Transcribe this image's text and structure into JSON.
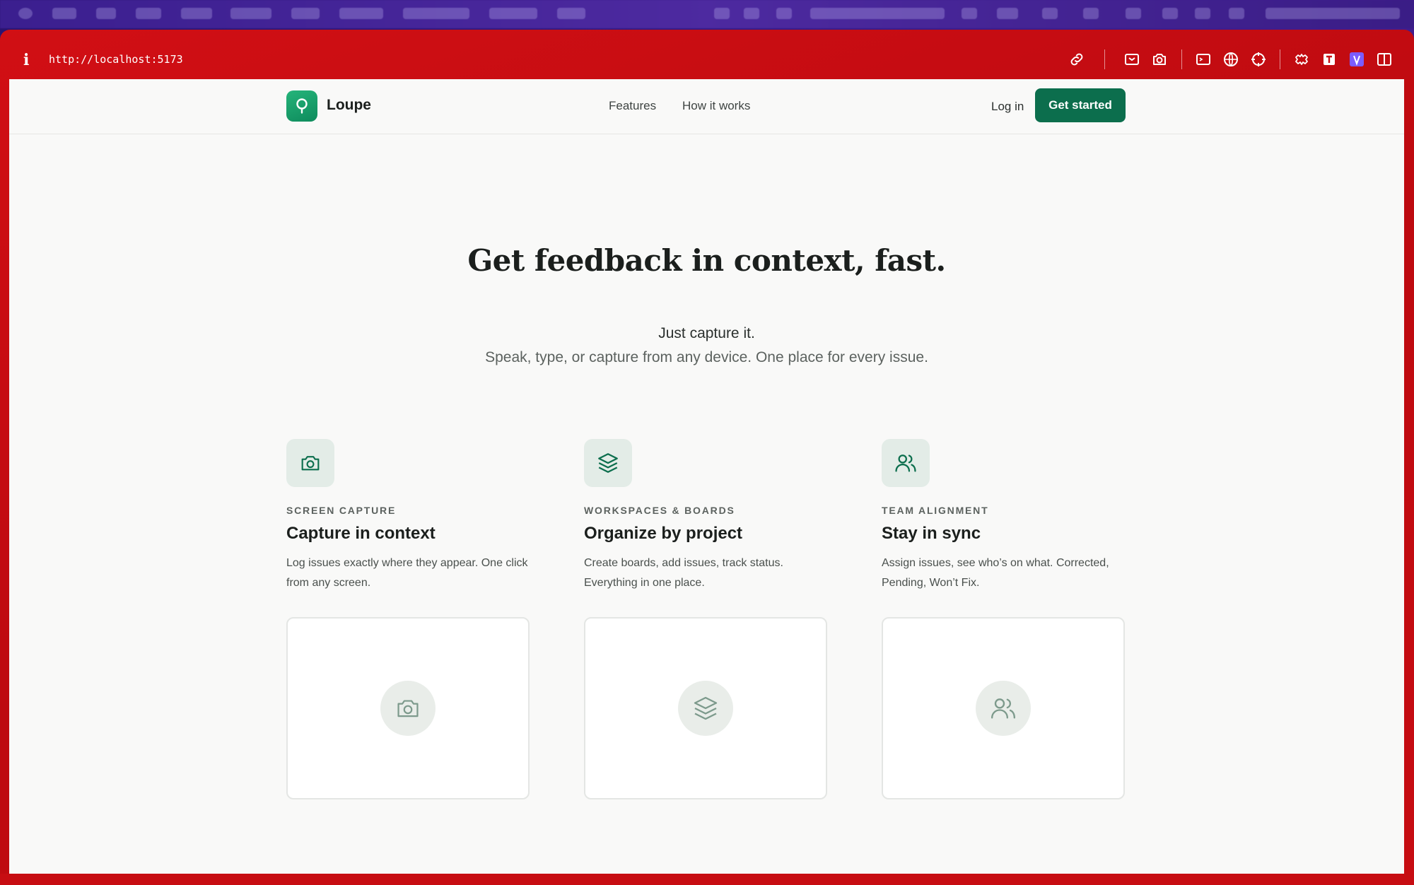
{
  "browser": {
    "url": "http://localhost:5173",
    "info_icon": "i"
  },
  "site": {
    "brand": "Loupe",
    "nav_links": [
      "Features",
      "How it works"
    ],
    "login_label": "Log in",
    "cta_label": "Get started"
  },
  "hero": {
    "title": "Get feedback in context, fast.",
    "subtitle": "Just capture it.",
    "description": "Speak, type, or capture from any device. One place for every issue."
  },
  "features": [
    {
      "icon": "camera-icon",
      "eyebrow": "SCREEN CAPTURE",
      "title": "Capture in context",
      "description": "Log issues exactly where they appear. One click from any screen."
    },
    {
      "icon": "layers-icon",
      "eyebrow": "WORKSPACES & BOARDS",
      "title": "Organize by project",
      "description": "Create boards, add issues, track status. Everything in one place."
    },
    {
      "icon": "users-icon",
      "eyebrow": "TEAM ALIGNMENT",
      "title": "Stay in sync",
      "description": "Assign issues, see who’s on what. Corrected, Pending, Won’t Fix."
    }
  ],
  "colors": {
    "accent": "#0c6e4d",
    "brand_gradient": "#25b47a",
    "frame": "#c70d12",
    "page_bg": "#f9f9f8"
  }
}
